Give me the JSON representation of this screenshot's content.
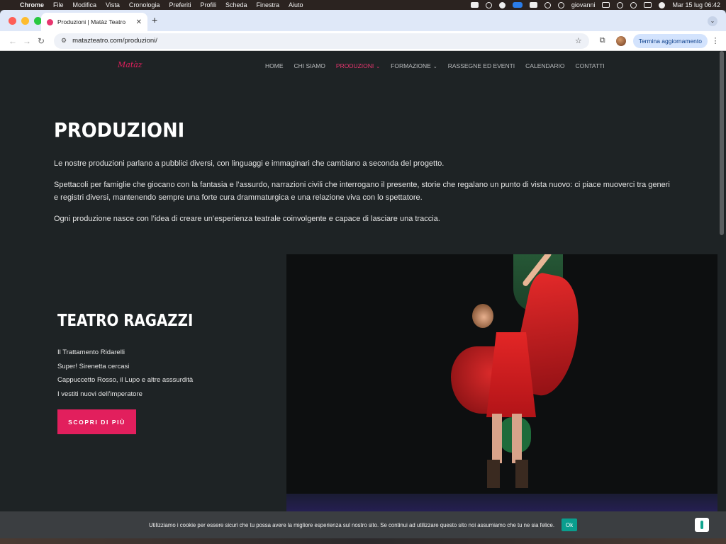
{
  "menubar": {
    "app": "Chrome",
    "items": [
      "File",
      "Modifica",
      "Vista",
      "Cronologia",
      "Preferiti",
      "Profili",
      "Scheda",
      "Finestra",
      "Aiuto"
    ],
    "user": "giovanni",
    "datetime": "Mar 15 lug  06:42"
  },
  "browser": {
    "tab_title": "Produzioni | Matàz Teatro",
    "url": "matazteatro.com/produzioni/",
    "update_button": "Termina aggiornamento"
  },
  "site": {
    "logo": "Matàz",
    "nav": [
      {
        "label": "HOME"
      },
      {
        "label": "CHI SIAMO"
      },
      {
        "label": "PRODUZIONI"
      },
      {
        "label": "FORMAZIONE"
      },
      {
        "label": "RASSEGNE ED EVENTI"
      },
      {
        "label": "CALENDARIO"
      },
      {
        "label": "CONTATTI"
      }
    ],
    "active_color": "#e8366f"
  },
  "hero": {
    "title": "PRODUZIONI",
    "paragraphs": [
      "Le nostre produzioni parlano a pubblici diversi, con linguaggi e immaginari che cambiano a seconda del progetto.",
      "Spettacoli per famiglie che giocano con la fantasia e l’assurdo, narrazioni civili che interrogano il presente, storie che regalano un punto di vista nuovo: ci piace muoverci tra generi e registri diversi, mantenendo sempre una forte cura drammaturgica e una relazione viva con lo spettatore.",
      "Ogni produzione nasce con l’idea di creare un’esperienza teatrale coinvolgente e capace di lasciare una traccia."
    ]
  },
  "section": {
    "title": "TEATRO RAGAZZI",
    "items": [
      "Il Trattamento Ridarelli",
      "Super! Sirenetta cercasi",
      "Cappuccetto Rosso, il Lupo e altre asssurdità",
      "I vestiti nuovi dell’imperatore"
    ],
    "cta": "SCOPRI DI PIÙ",
    "cta_color": "#e21f5d"
  },
  "cookie": {
    "text": "Utilizziamo i cookie per essere sicuri che tu possa avere la migliore esperienza sul nostro sito. Se continui ad utilizzare questo sito noi assumiamo che tu ne sia felice.",
    "ok": "Ok"
  }
}
